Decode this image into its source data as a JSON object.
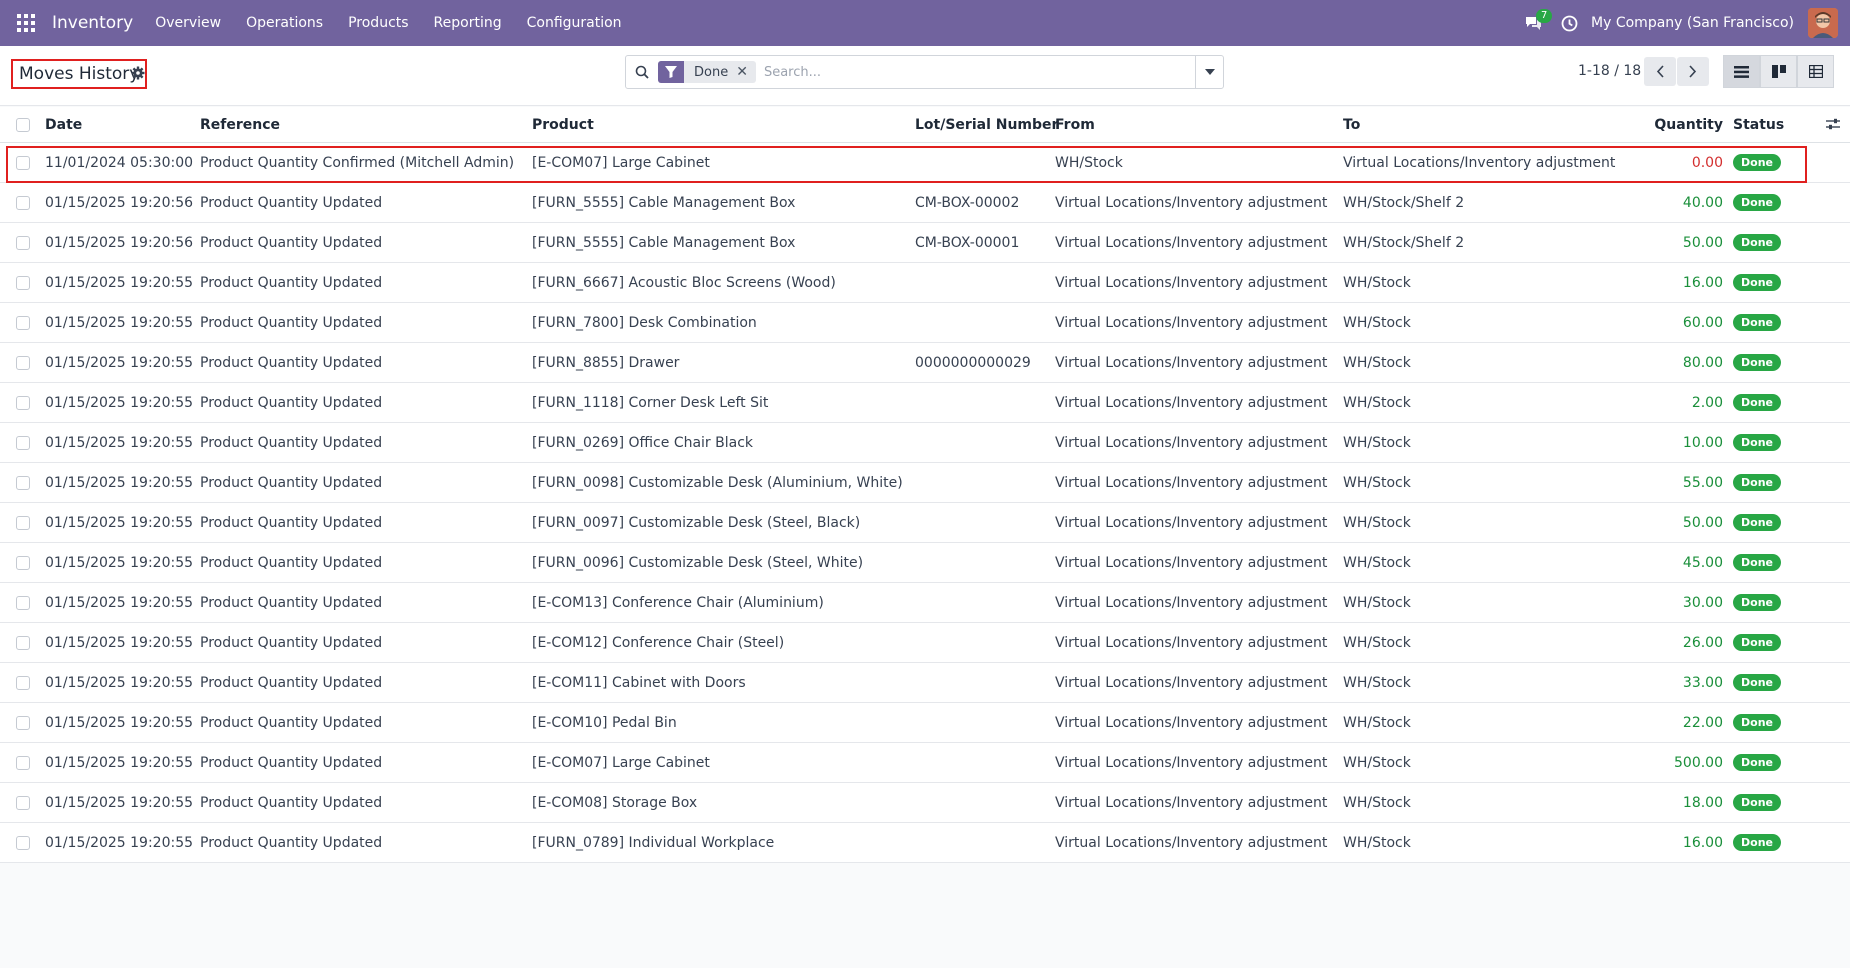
{
  "navbar": {
    "app_name": "Inventory",
    "menu": [
      "Overview",
      "Operations",
      "Products",
      "Reporting",
      "Configuration"
    ],
    "chat_count": "7",
    "company": "My Company (San Francisco)"
  },
  "control": {
    "title": "Moves History",
    "facet_label": "Done",
    "search_placeholder": "Search...",
    "pager": "1-18 / 18"
  },
  "table": {
    "headers": {
      "date": "Date",
      "reference": "Reference",
      "product": "Product",
      "lot": "Lot/Serial Number",
      "from": "From",
      "to": "To",
      "quantity": "Quantity",
      "status": "Status"
    },
    "rows": [
      {
        "date": "11/01/2024 05:30:00",
        "reference": "Product Quantity Confirmed (Mitchell Admin)",
        "product": "[E-COM07] Large Cabinet",
        "lot": "",
        "from": "WH/Stock",
        "to": "Virtual Locations/Inventory adjustment",
        "quantity": "0.00",
        "status": "Done"
      },
      {
        "date": "01/15/2025 19:20:56",
        "reference": "Product Quantity Updated",
        "product": "[FURN_5555] Cable Management Box",
        "lot": "CM-BOX-00002",
        "from": "Virtual Locations/Inventory adjustment",
        "to": "WH/Stock/Shelf 2",
        "quantity": "40.00",
        "status": "Done"
      },
      {
        "date": "01/15/2025 19:20:56",
        "reference": "Product Quantity Updated",
        "product": "[FURN_5555] Cable Management Box",
        "lot": "CM-BOX-00001",
        "from": "Virtual Locations/Inventory adjustment",
        "to": "WH/Stock/Shelf 2",
        "quantity": "50.00",
        "status": "Done"
      },
      {
        "date": "01/15/2025 19:20:55",
        "reference": "Product Quantity Updated",
        "product": "[FURN_6667] Acoustic Bloc Screens (Wood)",
        "lot": "",
        "from": "Virtual Locations/Inventory adjustment",
        "to": "WH/Stock",
        "quantity": "16.00",
        "status": "Done"
      },
      {
        "date": "01/15/2025 19:20:55",
        "reference": "Product Quantity Updated",
        "product": "[FURN_7800] Desk Combination",
        "lot": "",
        "from": "Virtual Locations/Inventory adjustment",
        "to": "WH/Stock",
        "quantity": "60.00",
        "status": "Done"
      },
      {
        "date": "01/15/2025 19:20:55",
        "reference": "Product Quantity Updated",
        "product": "[FURN_8855] Drawer",
        "lot": "0000000000029",
        "from": "Virtual Locations/Inventory adjustment",
        "to": "WH/Stock",
        "quantity": "80.00",
        "status": "Done"
      },
      {
        "date": "01/15/2025 19:20:55",
        "reference": "Product Quantity Updated",
        "product": "[FURN_1118] Corner Desk Left Sit",
        "lot": "",
        "from": "Virtual Locations/Inventory adjustment",
        "to": "WH/Stock",
        "quantity": "2.00",
        "status": "Done"
      },
      {
        "date": "01/15/2025 19:20:55",
        "reference": "Product Quantity Updated",
        "product": "[FURN_0269] Office Chair Black",
        "lot": "",
        "from": "Virtual Locations/Inventory adjustment",
        "to": "WH/Stock",
        "quantity": "10.00",
        "status": "Done"
      },
      {
        "date": "01/15/2025 19:20:55",
        "reference": "Product Quantity Updated",
        "product": "[FURN_0098] Customizable Desk (Aluminium, White)",
        "lot": "",
        "from": "Virtual Locations/Inventory adjustment",
        "to": "WH/Stock",
        "quantity": "55.00",
        "status": "Done"
      },
      {
        "date": "01/15/2025 19:20:55",
        "reference": "Product Quantity Updated",
        "product": "[FURN_0097] Customizable Desk (Steel, Black)",
        "lot": "",
        "from": "Virtual Locations/Inventory adjustment",
        "to": "WH/Stock",
        "quantity": "50.00",
        "status": "Done"
      },
      {
        "date": "01/15/2025 19:20:55",
        "reference": "Product Quantity Updated",
        "product": "[FURN_0096] Customizable Desk (Steel, White)",
        "lot": "",
        "from": "Virtual Locations/Inventory adjustment",
        "to": "WH/Stock",
        "quantity": "45.00",
        "status": "Done"
      },
      {
        "date": "01/15/2025 19:20:55",
        "reference": "Product Quantity Updated",
        "product": "[E-COM13] Conference Chair (Aluminium)",
        "lot": "",
        "from": "Virtual Locations/Inventory adjustment",
        "to": "WH/Stock",
        "quantity": "30.00",
        "status": "Done"
      },
      {
        "date": "01/15/2025 19:20:55",
        "reference": "Product Quantity Updated",
        "product": "[E-COM12] Conference Chair (Steel)",
        "lot": "",
        "from": "Virtual Locations/Inventory adjustment",
        "to": "WH/Stock",
        "quantity": "26.00",
        "status": "Done"
      },
      {
        "date": "01/15/2025 19:20:55",
        "reference": "Product Quantity Updated",
        "product": "[E-COM11] Cabinet with Doors",
        "lot": "",
        "from": "Virtual Locations/Inventory adjustment",
        "to": "WH/Stock",
        "quantity": "33.00",
        "status": "Done"
      },
      {
        "date": "01/15/2025 19:20:55",
        "reference": "Product Quantity Updated",
        "product": "[E-COM10] Pedal Bin",
        "lot": "",
        "from": "Virtual Locations/Inventory adjustment",
        "to": "WH/Stock",
        "quantity": "22.00",
        "status": "Done"
      },
      {
        "date": "01/15/2025 19:20:55",
        "reference": "Product Quantity Updated",
        "product": "[E-COM07] Large Cabinet",
        "lot": "",
        "from": "Virtual Locations/Inventory adjustment",
        "to": "WH/Stock",
        "quantity": "500.00",
        "status": "Done"
      },
      {
        "date": "01/15/2025 19:20:55",
        "reference": "Product Quantity Updated",
        "product": "[E-COM08] Storage Box",
        "lot": "",
        "from": "Virtual Locations/Inventory adjustment",
        "to": "WH/Stock",
        "quantity": "18.00",
        "status": "Done"
      },
      {
        "date": "01/15/2025 19:20:55",
        "reference": "Product Quantity Updated",
        "product": "[FURN_0789] Individual Workplace",
        "lot": "",
        "from": "Virtual Locations/Inventory adjustment",
        "to": "WH/Stock",
        "quantity": "16.00",
        "status": "Done"
      }
    ]
  },
  "colors": {
    "navbar": "#71639e",
    "status_done": "#28a745",
    "qty_positive": "#1a8f3a",
    "qty_zero": "#d32f2f",
    "highlight": "#e0201f"
  },
  "icons": {
    "apps": "apps-grid-icon",
    "chat": "chat-icon",
    "activity": "clock-icon",
    "settings": "gear-icon",
    "search": "search-icon",
    "filter": "filter-icon",
    "prev": "chevron-left-icon",
    "next": "chevron-right-icon",
    "list_view": "list-view-icon",
    "kanban_view": "kanban-view-icon",
    "pivot_view": "pivot-view-icon",
    "optional_columns": "sliders-icon"
  }
}
